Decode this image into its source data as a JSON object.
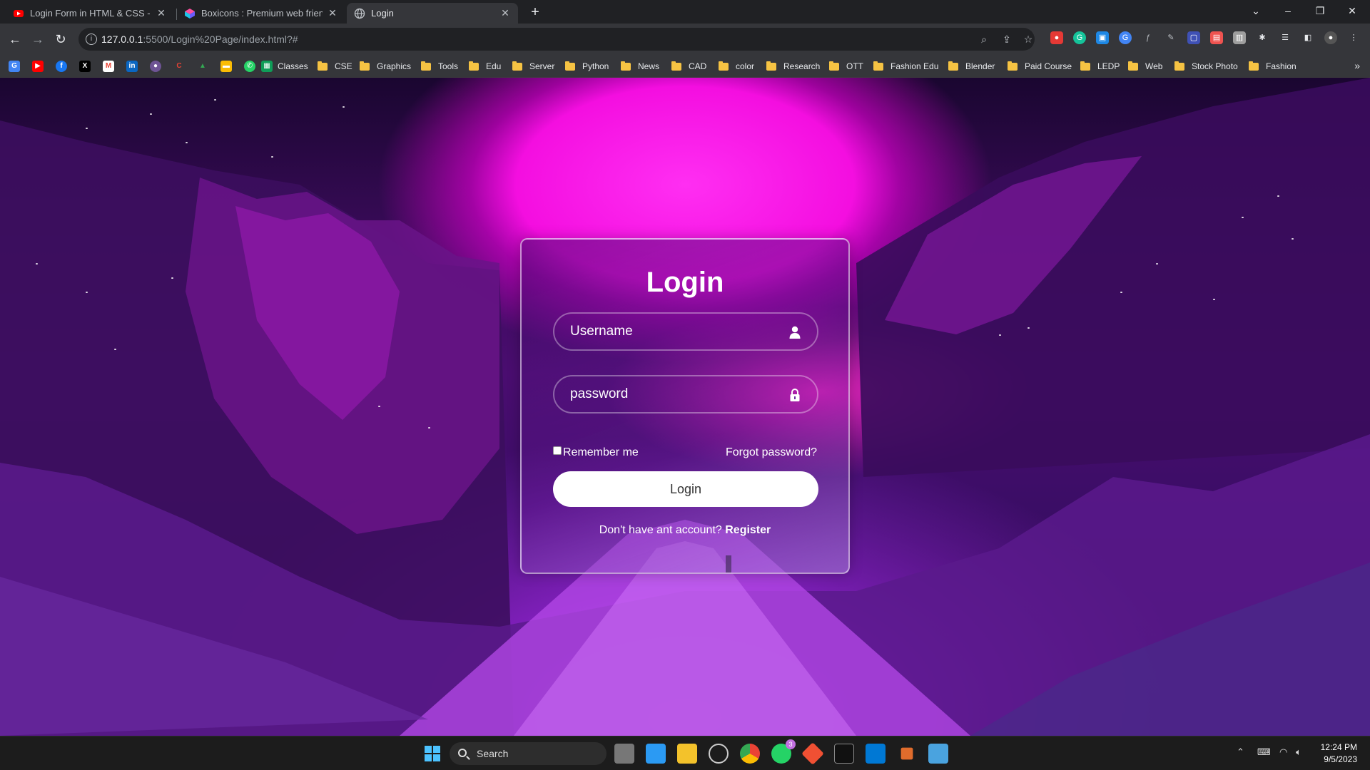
{
  "browser": {
    "tabs": [
      {
        "title": "Login Form in HTML & CSS - You",
        "icon": "youtube-icon",
        "active": false
      },
      {
        "title": "Boxicons : Premium web friendly",
        "icon": "boxicons-icon",
        "active": false
      },
      {
        "title": "Login",
        "icon": "globe-icon",
        "active": true
      }
    ],
    "url_host": "127.0.0.1",
    "url_rest": ":5500/Login%20Page/index.html?#",
    "bookmarks": [
      "Classes",
      "CSE",
      "Graphics",
      "Tools",
      "Edu",
      "Server",
      "Python",
      "News",
      "CAD",
      "color",
      "Research",
      "OTT",
      "Fashion Edu",
      "Blender",
      "Paid Course",
      "LEDP",
      "Web",
      "Stock Photo",
      "Fashion"
    ]
  },
  "login": {
    "title": "Login",
    "username_placeholder": "Username",
    "password_placeholder": "password",
    "remember_label": "Remember me",
    "forgot_label": "Forgot password?",
    "button_label": "Login",
    "register_prompt": "Don't have ant account?",
    "register_link": "Register"
  },
  "taskbar": {
    "search_label": "Search",
    "whatsapp_badge": "3",
    "time": "12:24 PM",
    "date": "9/5/2023"
  },
  "colors": {
    "glow": "#f40ee0",
    "sky_dark": "#1a0630",
    "purple": "#8a22c8"
  }
}
